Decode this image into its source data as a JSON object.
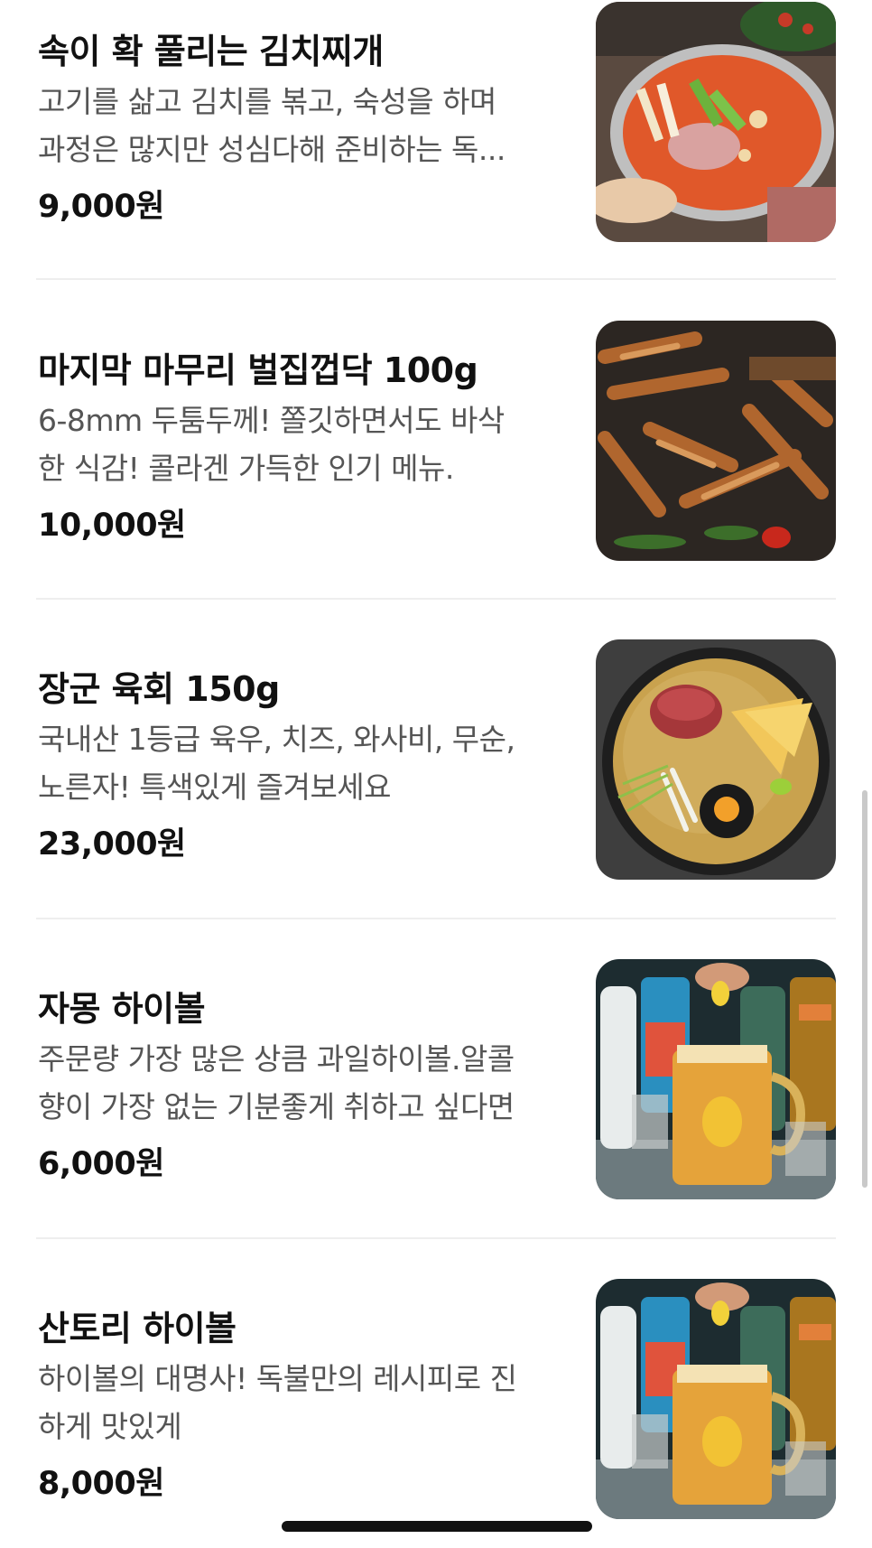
{
  "menu": {
    "items": [
      {
        "name": "속이 확 풀리는 김치찌개",
        "desc_line1": "고기를 삶고 김치를 볶고, 숙성을 하며",
        "desc_line2": "과정은 많지만 성심다해 준비하는 독...",
        "price": "9,000원",
        "image": "kimchi-stew-photo"
      },
      {
        "name": "마지막 마무리 벌집껍닥 100g",
        "desc_line1": "6-8mm 두툼두께! 쫄깃하면서도 바삭",
        "desc_line2": "한 식감! 콜라겐 가득한 인기 메뉴.",
        "price": "10,000원",
        "image": "grilled-pork-skin-photo"
      },
      {
        "name": "장군 육회 150g",
        "desc_line1": "국내산 1등급 육우, 치즈, 와사비, 무순,",
        "desc_line2": "노른자! 특색있게 즐겨보세요",
        "price": "23,000원",
        "image": "beef-tartare-photo"
      },
      {
        "name": "자몽 하이볼",
        "desc_line1": "주문량 가장 많은 상큼 과일하이볼.알콜",
        "desc_line2": "향이 가장 없는 기분좋게 취하고 싶다면",
        "price": "6,000원",
        "image": "highball-photo"
      },
      {
        "name": "산토리 하이볼",
        "desc_line1": "하이볼의 대명사! 독불만의 레시피로 진",
        "desc_line2": "하게 맛있게",
        "price": "8,000원",
        "image": "highball-photo"
      }
    ]
  },
  "colors": {
    "text_primary": "#111111",
    "text_secondary": "#555555",
    "divider": "#eeeeee",
    "background": "#ffffff"
  }
}
